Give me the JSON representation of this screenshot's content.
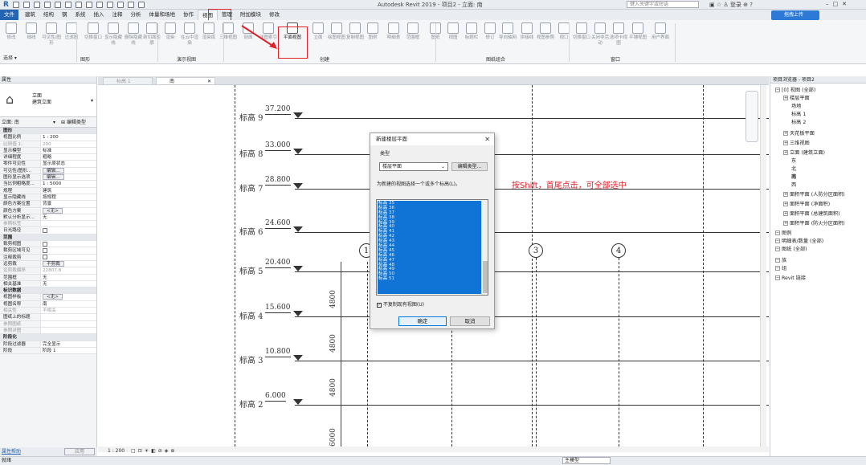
{
  "app": {
    "title": "Autodesk Revit 2019 - 项目2 - 立面: 南",
    "search_placeholder": "键入关键字或短语",
    "login": "登录",
    "cloud_button": "拖拽上传",
    "accent_color": "#2565b2"
  },
  "menu_tabs": [
    "文件",
    "建筑",
    "结构",
    "钢",
    "系统",
    "插入",
    "注释",
    "分析",
    "体量和场地",
    "协作",
    "视图",
    "管理",
    "附加模块",
    "修改"
  ],
  "active_tab": "视图",
  "ribbon": {
    "buttons": [
      "修改",
      "细线",
      "可见性/图形",
      "过滤器",
      "切换窗口",
      "显示隐藏线",
      "删除隐藏线",
      "剖切面轮廓",
      "渲染",
      "在云中渲染",
      "渲染库",
      "三维视图",
      "剖面",
      "详图索引",
      "平面视图",
      "立面",
      "绘图视图",
      "复制视图",
      "图例",
      "明细表",
      "范围框",
      "图纸",
      "视图",
      "标题栏",
      "修订",
      "导向轴网",
      "拼接线",
      "视图参照",
      "视口",
      "切换窗口",
      "关闭非活动",
      "选项卡视图",
      "平铺视图",
      "用户界面"
    ],
    "panels": [
      "选择",
      "图形",
      "演示视图",
      "创建",
      "图纸组合",
      "窗口"
    ],
    "select_label": "选择 ▾"
  },
  "properties": {
    "header": "属性",
    "type_name_1": "立面",
    "type_name_2": "建筑立面",
    "filter": "立面: 南",
    "edit_type": "编辑类型",
    "rows": [
      {
        "k": "图形",
        "v": "",
        "sec": true
      },
      {
        "k": "视图比例",
        "v": "1 : 200"
      },
      {
        "k": "比例值 1:",
        "v": "200",
        "gray": true
      },
      {
        "k": "显示模型",
        "v": "标准"
      },
      {
        "k": "详细程度",
        "v": "粗略"
      },
      {
        "k": "零件可见性",
        "v": "显示原状态"
      },
      {
        "k": "可见性/图形...",
        "v": "编辑...",
        "btn": true
      },
      {
        "k": "图形显示选项",
        "v": "编辑...",
        "btn": true
      },
      {
        "k": "当比例粗略度...",
        "v": "1 : 5000"
      },
      {
        "k": "规程",
        "v": "建筑"
      },
      {
        "k": "显示隐藏线",
        "v": "按规程"
      },
      {
        "k": "颜色方案位置",
        "v": "背景"
      },
      {
        "k": "颜色方案",
        "v": "<无>",
        "btn": true
      },
      {
        "k": "默认分析显示...",
        "v": "无"
      },
      {
        "k": "参照标签",
        "v": "",
        "gray": true
      },
      {
        "k": "日光路径",
        "v": "",
        "chk": true
      },
      {
        "k": "范围",
        "v": "",
        "sec": true
      },
      {
        "k": "裁剪视图",
        "v": "",
        "chk": true
      },
      {
        "k": "裁剪区域可见",
        "v": "",
        "chk": true
      },
      {
        "k": "注释裁剪",
        "v": "",
        "chk": true
      },
      {
        "k": "远剪裁",
        "v": "不剪裁",
        "btn": true
      },
      {
        "k": "远剪裁偏移",
        "v": "22807.8",
        "gray": true
      },
      {
        "k": "范围框",
        "v": "无"
      },
      {
        "k": "相关基准",
        "v": "无"
      },
      {
        "k": "标识数据",
        "v": "",
        "sec": true
      },
      {
        "k": "视图样板",
        "v": "<无>",
        "btn": true
      },
      {
        "k": "视图名称",
        "v": "南"
      },
      {
        "k": "相关性",
        "v": "不相关",
        "gray": true
      },
      {
        "k": "图纸上的标题",
        "v": ""
      },
      {
        "k": "参照图纸",
        "v": "",
        "gray": true
      },
      {
        "k": "参照详图",
        "v": "",
        "gray": true
      },
      {
        "k": "阶段化",
        "v": "",
        "sec": true
      },
      {
        "k": "阶段过滤器",
        "v": "完全显示"
      },
      {
        "k": "阶段",
        "v": "阶段 1"
      }
    ],
    "help_link": "属性帮助",
    "apply": "应用"
  },
  "doc_tabs": [
    "标高 1",
    "南"
  ],
  "canvas": {
    "levels": [
      {
        "name": "标高 9",
        "elev": "37.200"
      },
      {
        "name": "标高 8",
        "elev": "33.000"
      },
      {
        "name": "标高 7",
        "elev": "28.800"
      },
      {
        "name": "标高 6",
        "elev": "24.600"
      },
      {
        "name": "标高 5",
        "elev": "20.400"
      },
      {
        "name": "标高 4",
        "elev": "15.600"
      },
      {
        "name": "标高 3",
        "elev": "10.800"
      },
      {
        "name": "标高 2",
        "elev": "6.000"
      }
    ],
    "grid_labels": [
      "1",
      "3",
      "4"
    ],
    "dims": [
      "4800",
      "4800",
      "4800",
      "6000"
    ],
    "annotation": "按Shift，首尾点击，可全部选中",
    "annotation_color": "#e3202a"
  },
  "dialog": {
    "title": "新建楼层平面",
    "type_label": "类型",
    "type_value": "楼层平面",
    "edit_type": "编辑类型...",
    "select_label": "为新建的视图选择一个或多个标高(L)。",
    "items": [
      "35",
      "36",
      "37",
      "38",
      "39",
      "40",
      "41",
      "42",
      "43",
      "44",
      "45",
      "46",
      "47",
      "48",
      "49",
      "50",
      "51"
    ],
    "item_prefix": "标高",
    "no_duplicate": "不复制现有视图(U)",
    "ok": "确定",
    "cancel": "取消"
  },
  "browser": {
    "header": "项目浏览器 - 项目2",
    "nodes": [
      {
        "t": "[0] 视图 (全部)",
        "d": 0
      },
      {
        "t": "楼层平面",
        "d": 1
      },
      {
        "t": "场地",
        "d": 2
      },
      {
        "t": "标高 1",
        "d": 2
      },
      {
        "t": "标高 2",
        "d": 2
      },
      {
        "t": "天花板平面",
        "d": 1
      },
      {
        "t": "三维视图",
        "d": 1
      },
      {
        "t": "立面 (建筑立面)",
        "d": 1
      },
      {
        "t": "东",
        "d": 2
      },
      {
        "t": "北",
        "d": 2
      },
      {
        "t": "南",
        "d": 2
      },
      {
        "t": "西",
        "d": 2
      },
      {
        "t": "面积平面 (人防分区面积)",
        "d": 1
      },
      {
        "t": "面积平面 (净面积)",
        "d": 1
      },
      {
        "t": "面积平面 (总建筑面积)",
        "d": 1
      },
      {
        "t": "面积平面 (防火分区面积)",
        "d": 1
      },
      {
        "t": "图例",
        "d": 0
      },
      {
        "t": "明细表/数量 (全部)",
        "d": 0
      },
      {
        "t": "图纸 (全部)",
        "d": 0
      },
      {
        "t": "族",
        "d": 0
      },
      {
        "t": "组",
        "d": 0
      },
      {
        "t": "Revit 链接",
        "d": 0
      }
    ]
  },
  "status": {
    "text": "就绪",
    "scale": "1 : 200",
    "model": "主模型"
  }
}
